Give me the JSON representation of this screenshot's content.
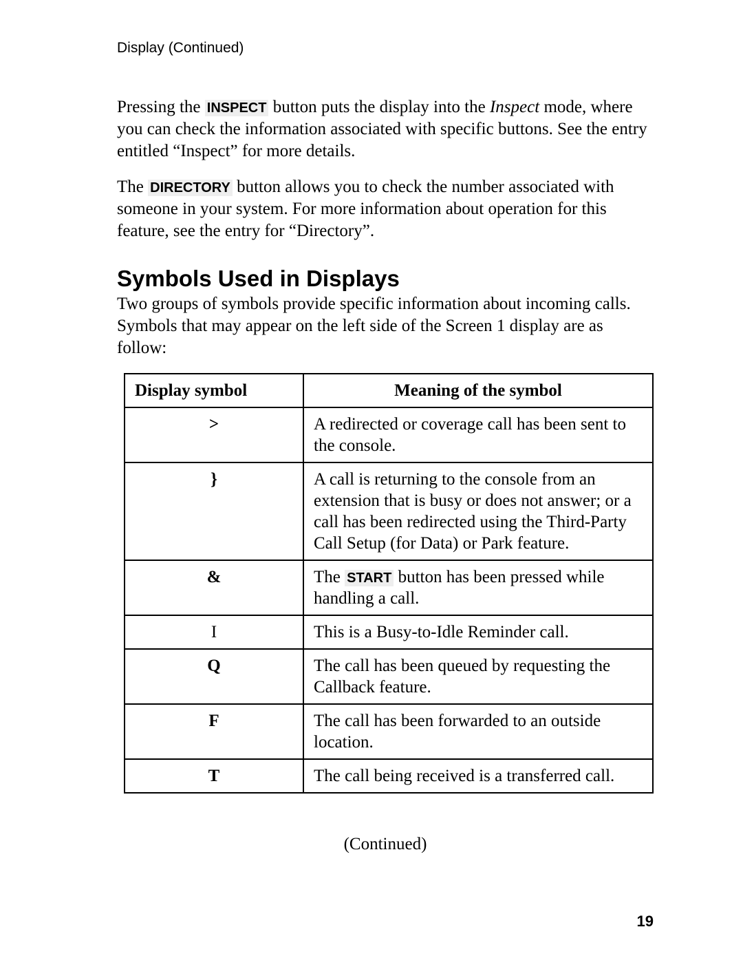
{
  "running_head": "Display  (Continued)",
  "para1_pre": "Pressing the ",
  "inspect_btn": "INSPECT",
  "para1_mid": " button puts the display into the ",
  "inspect_word": "Inspect",
  "para1_post": " mode, where you can check the information associated with specific buttons.   See the entry entitled “Inspect” for more details.",
  "para2_pre": "The ",
  "directory_btn": "DIRECTORY",
  "para2_post": " button allows you to check the number associated with someone in your system. For more information about operation for this feature, see the entry for “Directory”.",
  "section_title": "Symbols Used in Displays",
  "section_intro": "Two groups of symbols provide specific information about incoming calls.   Symbols that may appear on the left side of the Screen 1 display are as follow:",
  "th_symbol": "Display symbol",
  "th_meaning": "Meaning of the symbol",
  "rows": [
    {
      "sym": ">",
      "meaning_pre": "A redirected or coverage call has been sent to the console.",
      "btn": "",
      "meaning_post": ""
    },
    {
      "sym": "}",
      "meaning_pre": "A call is returning to the console from an extension that is busy or does not answer; or a call has been redirected using the Third-Party Call Setup (for Data) or Park feature.",
      "btn": "",
      "meaning_post": ""
    },
    {
      "sym": "&",
      "meaning_pre": "The ",
      "btn": "START",
      "meaning_post": " button has been pressed while handling a call."
    },
    {
      "sym": "I",
      "meaning_pre": "This is a Busy-to-Idle Reminder call.",
      "btn": "",
      "meaning_post": ""
    },
    {
      "sym": "Q",
      "meaning_pre": "The call has been queued by requesting the Callback feature.",
      "btn": "",
      "meaning_post": ""
    },
    {
      "sym": "F",
      "meaning_pre": "The call has been forwarded to an outside location.",
      "btn": "",
      "meaning_post": ""
    },
    {
      "sym": "T",
      "meaning_pre": "The call being received is a transferred call.",
      "btn": "",
      "meaning_post": ""
    }
  ],
  "continued": "(Continued)",
  "page_number": "19"
}
